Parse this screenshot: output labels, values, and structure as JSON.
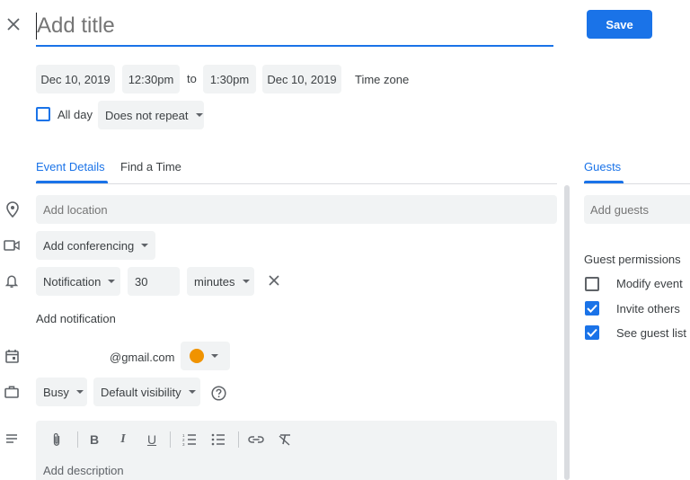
{
  "header": {
    "title_placeholder": "Add title",
    "save_label": "Save"
  },
  "datetime": {
    "start_date": "Dec 10, 2019",
    "start_time": "12:30pm",
    "to_label": "to",
    "end_time": "1:30pm",
    "end_date": "Dec 10, 2019",
    "timezone_label": "Time zone",
    "all_day_label": "All day",
    "all_day_checked": false,
    "repeat_label": "Does not repeat"
  },
  "tabs": {
    "event_details": "Event Details",
    "find_a_time": "Find a Time",
    "guests": "Guests"
  },
  "details": {
    "location_placeholder": "Add location",
    "conferencing_label": "Add conferencing",
    "notification_type": "Notification",
    "notification_value": "30",
    "notification_unit": "minutes",
    "add_notification_label": "Add notification",
    "calendar_email": "@gmail.com",
    "calendar_color": "#f09300",
    "availability": "Busy",
    "visibility": "Default visibility",
    "description_placeholder": "Add description"
  },
  "guests": {
    "add_guests_placeholder": "Add guests",
    "permissions_heading": "Guest permissions",
    "permissions": [
      {
        "label": "Modify event",
        "checked": false
      },
      {
        "label": "Invite others",
        "checked": true
      },
      {
        "label": "See guest list",
        "checked": true
      }
    ]
  },
  "colors": {
    "accent": "#1a73e8",
    "chip_bg": "#f1f3f4",
    "text": "#3c4043"
  }
}
